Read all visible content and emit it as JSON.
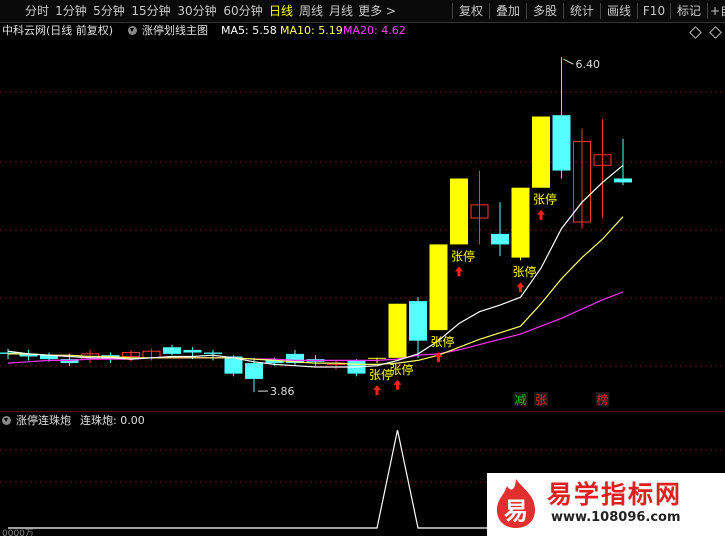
{
  "toolbar": {
    "periods": [
      {
        "label": "分时"
      },
      {
        "label": "1分钟"
      },
      {
        "label": "5分钟"
      },
      {
        "label": "15分钟"
      },
      {
        "label": "30分钟"
      },
      {
        "label": "60分钟"
      },
      {
        "label": "日线",
        "active": true
      },
      {
        "label": "周线"
      },
      {
        "label": "月线"
      },
      {
        "label": "更多 >"
      }
    ],
    "tools": [
      {
        "label": "复权"
      },
      {
        "label": "叠加"
      },
      {
        "label": "多股"
      },
      {
        "label": "统计"
      },
      {
        "label": "画线"
      },
      {
        "label": "F10"
      },
      {
        "label": "标记"
      },
      {
        "label": "+自选"
      }
    ]
  },
  "info": {
    "stock": "中科云网(日线 前复权)",
    "indicator": "涨停划线主图",
    "ma5": "MA5: 5.58",
    "ma10": "MA10: 5.19",
    "ma20": "MA20: 4.62"
  },
  "sub": {
    "name": "涨停连珠炮",
    "value": "连珠炮: 0.00",
    "axis_label": "0000万"
  },
  "colors": {
    "up_limit": "#ffff00",
    "up": "#ff3333",
    "down": "#54ffff",
    "ma5": "#ffffff",
    "ma10": "#ffff66",
    "ma20": "#ff33ff",
    "grid": "#6a1010",
    "active_tab": "#ffff00"
  },
  "chart_data": {
    "type": "candlestick",
    "title": "中科云网(日线 前复权)",
    "max_label": "6.40",
    "min_label": "3.86",
    "limit_label": "张停",
    "bottom_markers": [
      {
        "label": "减",
        "color": "#22aa22",
        "index": 25
      },
      {
        "label": "张",
        "color": "#ee2222",
        "index": 26
      },
      {
        "label": "榜",
        "color": "#ee2222",
        "index": 29
      }
    ],
    "candles": [
      {
        "o": 4.16,
        "h": 4.19,
        "l": 4.11,
        "c": 4.15
      },
      {
        "o": 4.15,
        "h": 4.18,
        "l": 4.1,
        "c": 4.13
      },
      {
        "o": 4.14,
        "h": 4.16,
        "l": 4.09,
        "c": 4.11
      },
      {
        "o": 4.11,
        "h": 4.15,
        "l": 4.06,
        "c": 4.08
      },
      {
        "o": 4.11,
        "h": 4.18,
        "l": 4.08,
        "c": 4.15
      },
      {
        "o": 4.14,
        "h": 4.16,
        "l": 4.08,
        "c": 4.11
      },
      {
        "o": 4.13,
        "h": 4.18,
        "l": 4.09,
        "c": 4.16
      },
      {
        "o": 4.12,
        "h": 4.19,
        "l": 4.1,
        "c": 4.17
      },
      {
        "o": 4.2,
        "h": 4.22,
        "l": 4.14,
        "c": 4.15
      },
      {
        "o": 4.18,
        "h": 4.2,
        "l": 4.11,
        "c": 4.16
      },
      {
        "o": 4.16,
        "h": 4.18,
        "l": 4.1,
        "c": 4.15
      },
      {
        "o": 4.13,
        "h": 4.14,
        "l": 3.98,
        "c": 4.0
      },
      {
        "o": 4.08,
        "h": 4.12,
        "l": 3.86,
        "c": 3.96
      },
      {
        "o": 4.1,
        "h": 4.12,
        "l": 4.06,
        "c": 4.08
      },
      {
        "o": 4.15,
        "h": 4.18,
        "l": 4.06,
        "c": 4.08
      },
      {
        "o": 4.11,
        "h": 4.14,
        "l": 4.06,
        "c": 4.09
      },
      {
        "o": 4.07,
        "h": 4.1,
        "l": 4.03,
        "c": 4.08
      },
      {
        "o": 4.1,
        "h": 4.11,
        "l": 3.98,
        "c": 4.0
      },
      {
        "o": 4.12,
        "h": 4.12,
        "l": 4.08,
        "c": 4.12,
        "limit": true
      },
      {
        "o": 4.12,
        "h": 4.53,
        "l": 4.12,
        "c": 4.53,
        "limit": true
      },
      {
        "o": 4.55,
        "h": 4.58,
        "l": 4.12,
        "c": 4.25
      },
      {
        "o": 4.33,
        "h": 4.98,
        "l": 4.33,
        "c": 4.98,
        "limit": true
      },
      {
        "o": 4.98,
        "h": 5.48,
        "l": 4.98,
        "c": 5.48,
        "limit": true
      },
      {
        "o": 5.18,
        "h": 5.54,
        "l": 4.98,
        "c": 5.28
      },
      {
        "o": 5.06,
        "h": 5.3,
        "l": 4.89,
        "c": 4.98
      },
      {
        "o": 4.88,
        "h": 5.41,
        "l": 4.86,
        "c": 5.41,
        "limit": true
      },
      {
        "o": 5.41,
        "h": 5.95,
        "l": 5.41,
        "c": 5.95,
        "limit": true
      },
      {
        "o": 5.96,
        "h": 6.4,
        "l": 5.48,
        "c": 5.54
      },
      {
        "o": 5.15,
        "h": 5.86,
        "l": 5.1,
        "c": 5.76
      },
      {
        "o": 5.58,
        "h": 5.93,
        "l": 5.18,
        "c": 5.66
      },
      {
        "o": 5.48,
        "h": 5.78,
        "l": 5.43,
        "c": 5.45
      }
    ],
    "ma5": [
      4.17,
      4.15,
      4.14,
      4.13,
      4.12,
      4.12,
      4.11,
      4.12,
      4.13,
      4.13,
      4.14,
      4.12,
      4.09,
      4.07,
      4.06,
      4.05,
      4.05,
      4.05,
      4.06,
      4.1,
      4.15,
      4.25,
      4.38,
      4.47,
      4.52,
      4.58,
      4.8,
      5.1,
      5.3,
      5.45,
      5.58
    ],
    "ma10": [
      4.15,
      4.15,
      4.14,
      4.14,
      4.13,
      4.13,
      4.12,
      4.12,
      4.12,
      4.12,
      4.12,
      4.12,
      4.11,
      4.1,
      4.09,
      4.08,
      4.08,
      4.07,
      4.07,
      4.08,
      4.1,
      4.14,
      4.2,
      4.26,
      4.31,
      4.36,
      4.53,
      4.72,
      4.88,
      5.02,
      5.19
    ],
    "ma20": [
      4.08,
      4.09,
      4.1,
      4.1,
      4.11,
      4.11,
      4.11,
      4.12,
      4.12,
      4.12,
      4.12,
      4.12,
      4.11,
      4.11,
      4.1,
      4.1,
      4.1,
      4.1,
      4.1,
      4.11,
      4.14,
      4.15,
      4.18,
      4.22,
      4.26,
      4.3,
      4.36,
      4.42,
      4.49,
      4.56,
      4.62
    ],
    "signal": [
      0,
      0,
      0,
      0,
      0,
      0,
      0,
      0,
      0,
      0,
      0,
      0,
      0,
      0,
      0,
      0,
      0,
      0,
      0,
      1,
      0,
      0,
      0,
      0,
      0,
      0,
      0,
      0,
      0,
      0,
      0
    ],
    "ylim": [
      3.8,
      6.5
    ]
  }
}
